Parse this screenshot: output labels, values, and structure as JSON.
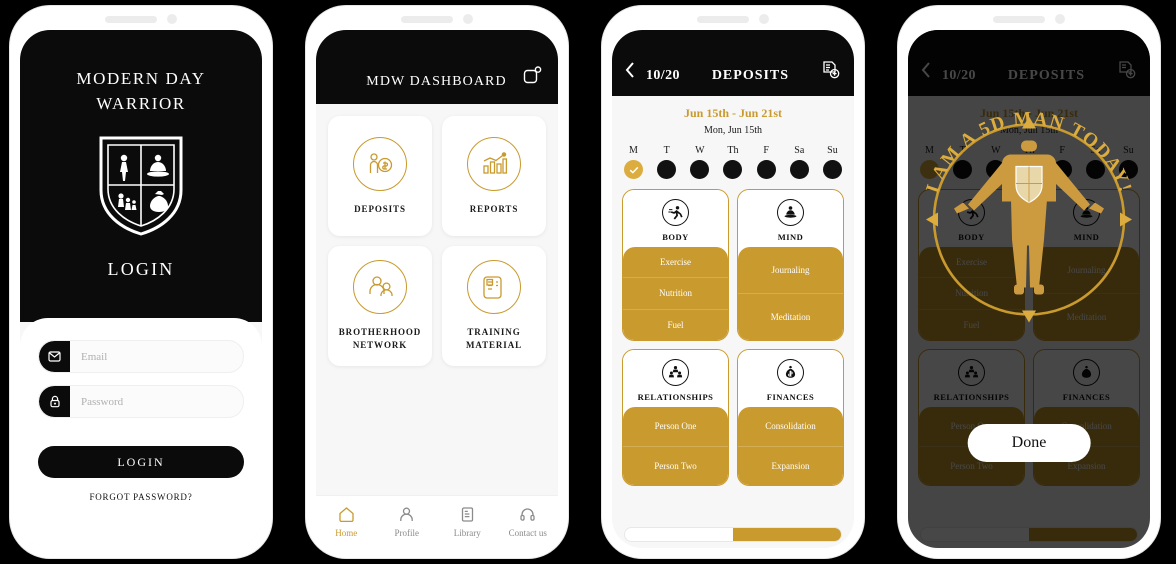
{
  "theme": {
    "gold": "#C99A2E",
    "gold_light": "#DCAD3E",
    "black": "#0B0B0B",
    "bg": "#F7F7F7"
  },
  "login_screen": {
    "brand_line1": "MODERN DAY",
    "brand_line2": "WARRIOR",
    "logo_icon": "shield-quadrant-logo",
    "heading": "LOGIN",
    "email": {
      "icon": "envelope-icon",
      "value": "",
      "placeholder": "Email"
    },
    "password": {
      "icon": "lock-icon",
      "value": "",
      "placeholder": "Password"
    },
    "login_button": "LOGIN",
    "forgot_password": "FORGOT PASSWORD?"
  },
  "dashboard_screen": {
    "title": "MDW DASHBOARD",
    "notification_icon": "notification-square-icon",
    "tiles": [
      {
        "label": "DEPOSITS",
        "icon": "person-coin-icon"
      },
      {
        "label": "REPORTS",
        "icon": "bar-chart-icon"
      },
      {
        "label": "BROTHERHOOD NETWORK",
        "icon": "people-group-icon"
      },
      {
        "label": "TRAINING MATERIAL",
        "icon": "document-scroll-icon"
      }
    ],
    "tabs": [
      {
        "label": "Home",
        "icon": "home-icon",
        "active": true
      },
      {
        "label": "Profile",
        "icon": "person-icon",
        "active": false
      },
      {
        "label": "Library",
        "icon": "book-icon",
        "active": false
      },
      {
        "label": "Contact us",
        "icon": "headset-icon",
        "active": false
      }
    ]
  },
  "deposits_screen": {
    "back_icon": "chevron-left-icon",
    "counter": "10/20",
    "title": "DEPOSITS",
    "add_icon": "document-add-icon",
    "week_range": "Jun 15th - Jun 21st",
    "selected_day_label": "Mon, Jun 15th",
    "days": [
      {
        "letter": "M",
        "selected": true
      },
      {
        "letter": "T",
        "selected": false
      },
      {
        "letter": "W",
        "selected": false
      },
      {
        "letter": "Th",
        "selected": false
      },
      {
        "letter": "F",
        "selected": false
      },
      {
        "letter": "Sa",
        "selected": false
      },
      {
        "letter": "Su",
        "selected": false
      }
    ],
    "categories": [
      {
        "name": "BODY",
        "icon": "running-person-icon",
        "items": [
          "Exercise",
          "Nutrition",
          "Fuel"
        ]
      },
      {
        "name": "MIND",
        "icon": "meditation-icon",
        "items": [
          "Journaling",
          "Meditation"
        ]
      },
      {
        "name": "RELATIONSHIPS",
        "icon": "people-group-icon",
        "items": [
          "Person One",
          "Person Two"
        ]
      },
      {
        "name": "FINANCES",
        "icon": "money-bag-icon",
        "items": [
          "Consolidation",
          "Expansion"
        ]
      }
    ],
    "progress_percent": 50
  },
  "overlay_screen": {
    "badge_text": "I AM A 5D MAN TODAY!",
    "figure_icon": "gold-man-shield-icon",
    "done_button": "Done"
  }
}
